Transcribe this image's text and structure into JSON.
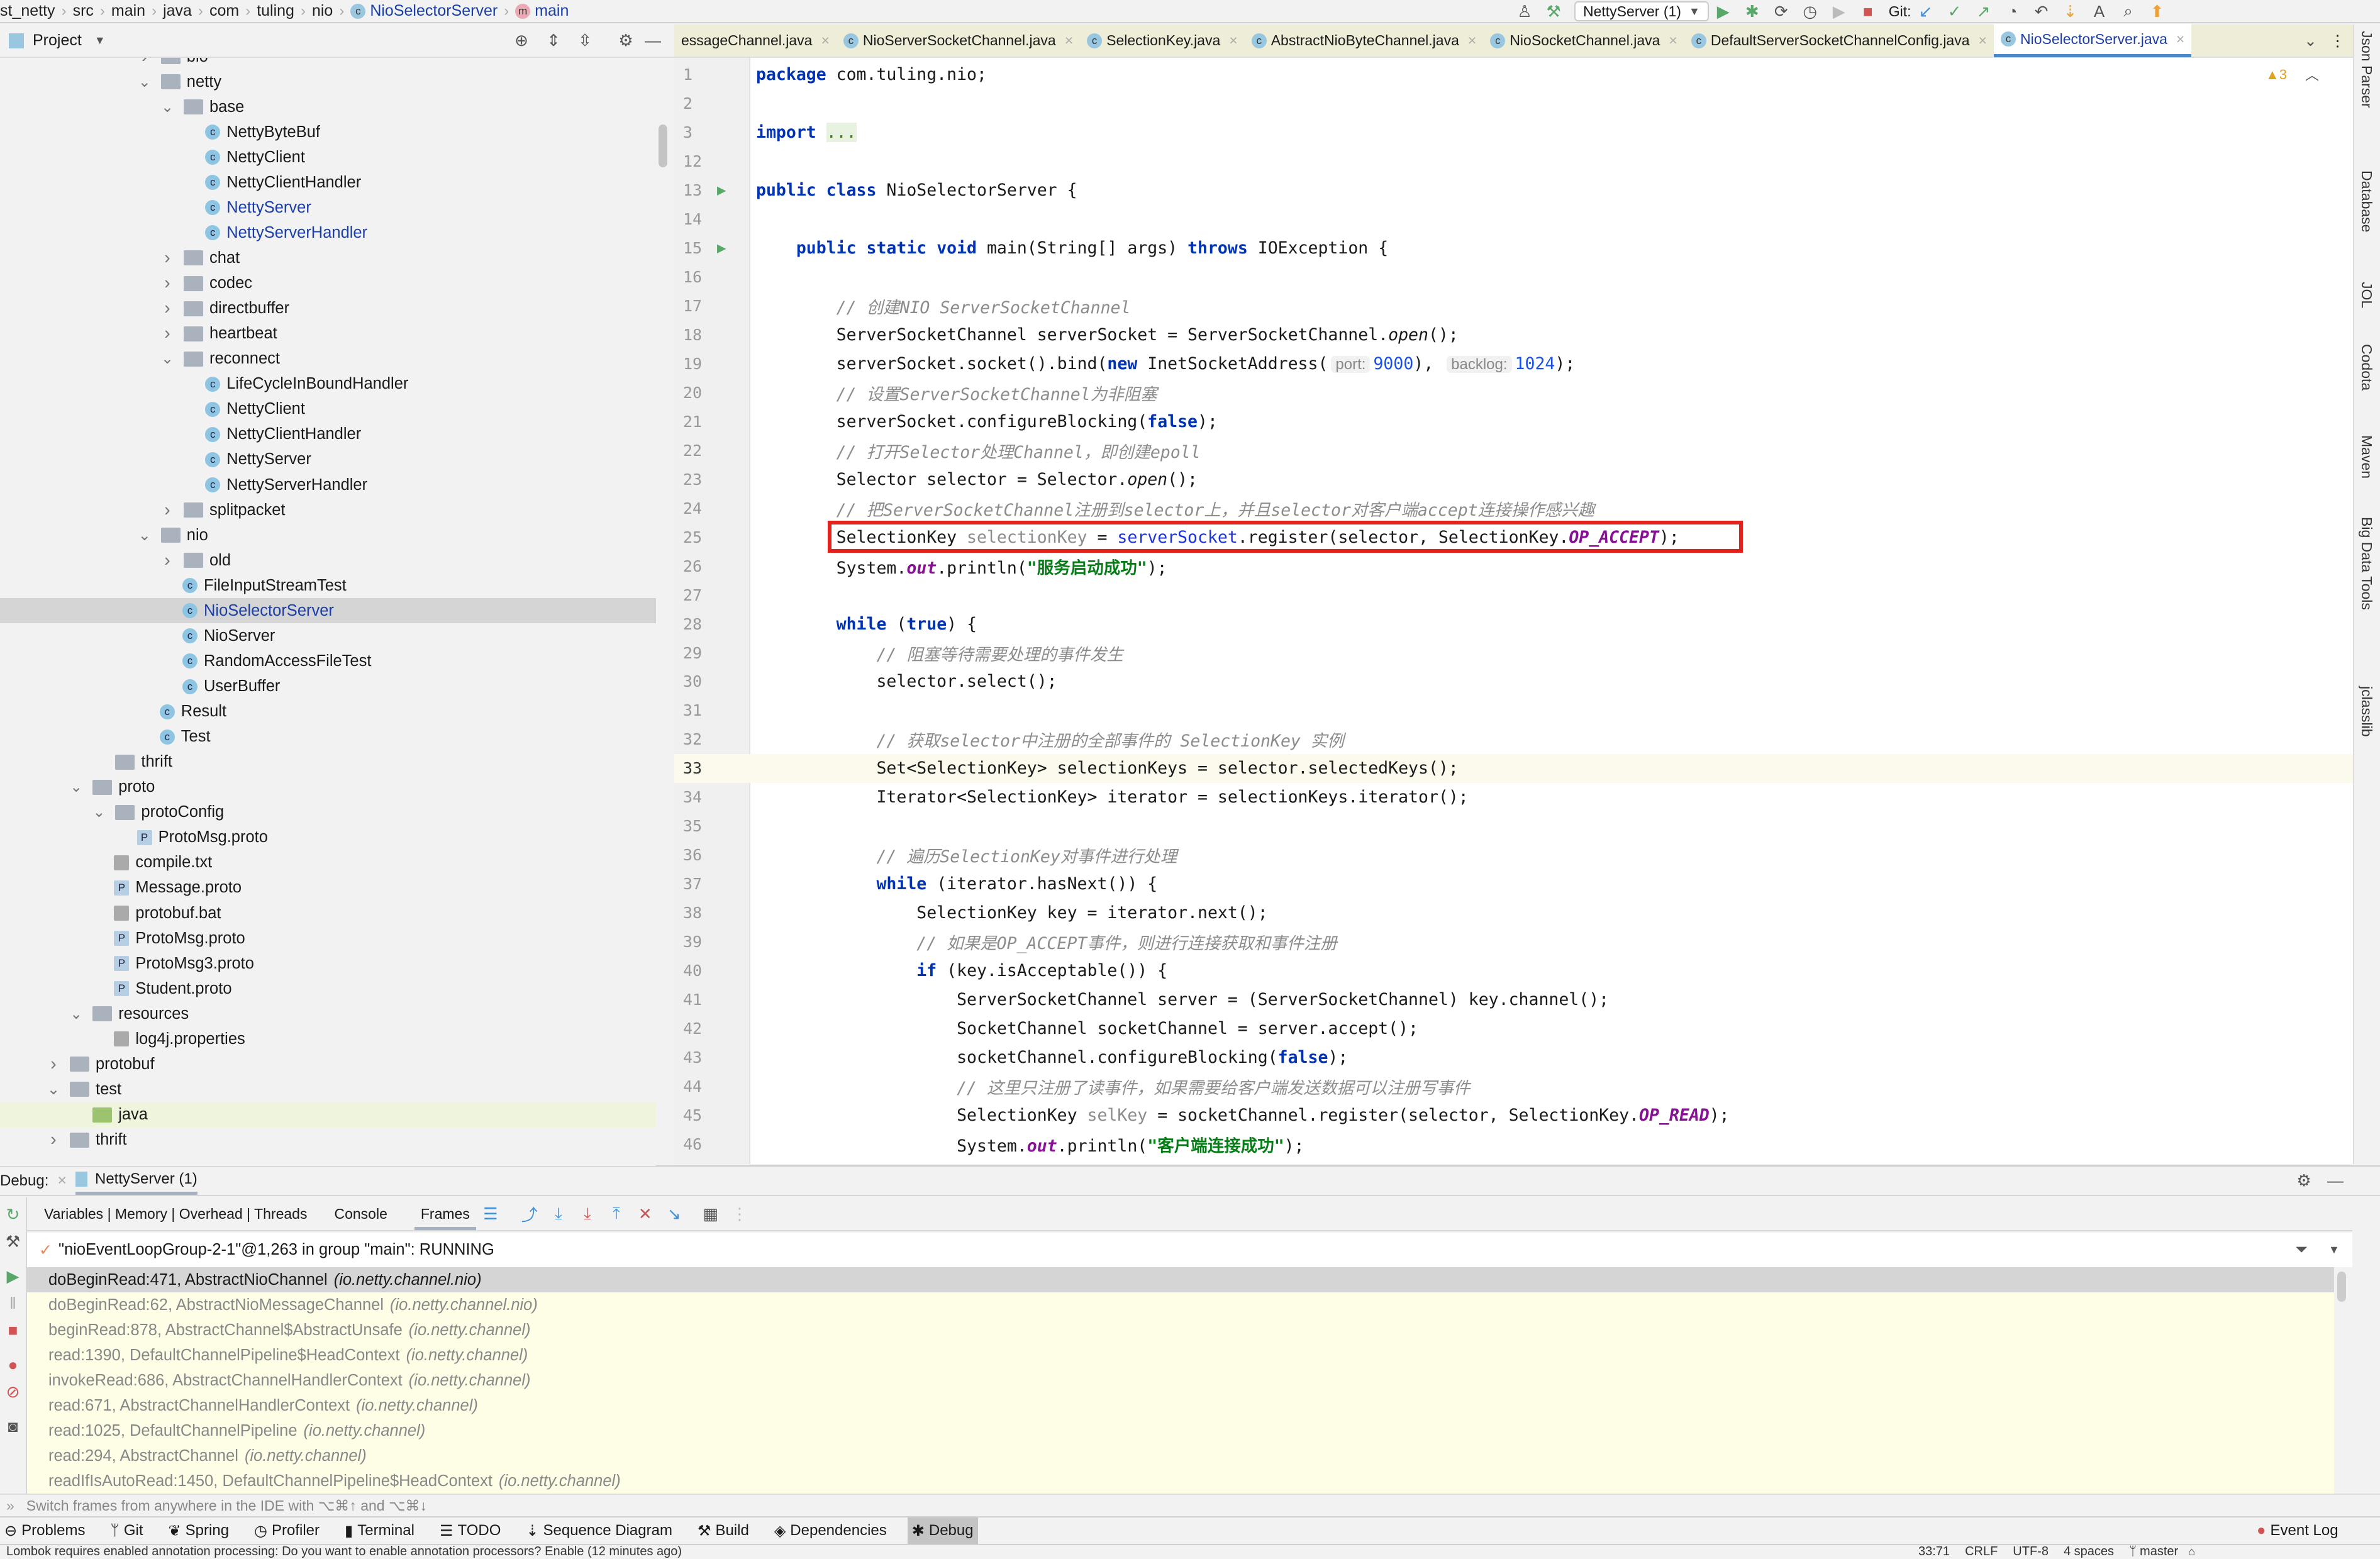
{
  "breadcrumb": [
    "st_netty",
    "src",
    "main",
    "java",
    "com",
    "tuling",
    "nio",
    "NioSelectorServer",
    "main"
  ],
  "toolbar": {
    "run_config": "NettyServer (1)",
    "git_label": "Git:"
  },
  "project": {
    "title": "Project"
  },
  "tabs": [
    "essageChannel.java",
    "NioServerSocketChannel.java",
    "SelectionKey.java",
    "AbstractNioByteChannel.java",
    "NioSocketChannel.java",
    "DefaultServerSocketChannelConfig.java",
    "NioSelectorServer.java"
  ],
  "active_tab": 6,
  "tree": [
    {
      "label": "bio",
      "level": 4,
      "type": "folder",
      "arrow": "right"
    },
    {
      "label": "netty",
      "level": 4,
      "type": "folder",
      "arrow": "down"
    },
    {
      "label": "base",
      "level": 5,
      "type": "folder",
      "arrow": "down"
    },
    {
      "label": "NettyByteBuf",
      "level": 6,
      "type": "class"
    },
    {
      "label": "NettyClient",
      "level": 6,
      "type": "class"
    },
    {
      "label": "NettyClientHandler",
      "level": 6,
      "type": "class"
    },
    {
      "label": "NettyServer",
      "level": 6,
      "type": "class",
      "blue": true
    },
    {
      "label": "NettyServerHandler",
      "level": 6,
      "type": "class",
      "blue": true
    },
    {
      "label": "chat",
      "level": 5,
      "type": "folder",
      "arrow": "right"
    },
    {
      "label": "codec",
      "level": 5,
      "type": "folder",
      "arrow": "right"
    },
    {
      "label": "directbuffer",
      "level": 5,
      "type": "folder",
      "arrow": "right"
    },
    {
      "label": "heartbeat",
      "level": 5,
      "type": "folder",
      "arrow": "right"
    },
    {
      "label": "reconnect",
      "level": 5,
      "type": "folder",
      "arrow": "down"
    },
    {
      "label": "LifeCycleInBoundHandler",
      "level": 6,
      "type": "class"
    },
    {
      "label": "NettyClient",
      "level": 6,
      "type": "class"
    },
    {
      "label": "NettyClientHandler",
      "level": 6,
      "type": "class"
    },
    {
      "label": "NettyServer",
      "level": 6,
      "type": "class"
    },
    {
      "label": "NettyServerHandler",
      "level": 6,
      "type": "class"
    },
    {
      "label": "splitpacket",
      "level": 5,
      "type": "folder",
      "arrow": "right"
    },
    {
      "label": "nio",
      "level": 4,
      "type": "folder",
      "arrow": "down"
    },
    {
      "label": "old",
      "level": 5,
      "type": "folder",
      "arrow": "right"
    },
    {
      "label": "FileInputStreamTest",
      "level": 5,
      "type": "class"
    },
    {
      "label": "NioSelectorServer",
      "level": 5,
      "type": "class",
      "blue": true,
      "selected": true
    },
    {
      "label": "NioServer",
      "level": 5,
      "type": "class"
    },
    {
      "label": "RandomAccessFileTest",
      "level": 5,
      "type": "class"
    },
    {
      "label": "UserBuffer",
      "level": 5,
      "type": "class"
    },
    {
      "label": "Result",
      "level": 4,
      "type": "class"
    },
    {
      "label": "Test",
      "level": 4,
      "type": "class"
    },
    {
      "label": "thrift",
      "level": 2,
      "type": "folder"
    },
    {
      "label": "proto",
      "level": 1,
      "type": "folder",
      "arrow": "down"
    },
    {
      "label": "protoConfig",
      "level": 2,
      "type": "folder",
      "arrow": "down"
    },
    {
      "label": "ProtoMsg.proto",
      "level": 3,
      "type": "proto"
    },
    {
      "label": "compile.txt",
      "level": 2,
      "type": "text"
    },
    {
      "label": "Message.proto",
      "level": 2,
      "type": "proto"
    },
    {
      "label": "protobuf.bat",
      "level": 2,
      "type": "text"
    },
    {
      "label": "ProtoMsg.proto",
      "level": 2,
      "type": "proto"
    },
    {
      "label": "ProtoMsg3.proto",
      "level": 2,
      "type": "proto"
    },
    {
      "label": "Student.proto",
      "level": 2,
      "type": "proto"
    },
    {
      "label": "resources",
      "level": 1,
      "type": "folder",
      "arrow": "down"
    },
    {
      "label": "log4j.properties",
      "level": 2,
      "type": "text"
    },
    {
      "label": "protobuf",
      "level": 0,
      "type": "folder",
      "arrow": "right"
    },
    {
      "label": "test",
      "level": 0,
      "type": "folder",
      "arrow": "down"
    },
    {
      "label": "java",
      "level": 1,
      "type": "folder",
      "highlight": true
    },
    {
      "label": "thrift",
      "level": 0,
      "type": "folder",
      "arrow": "right"
    }
  ],
  "editor": {
    "warnings": "▲3",
    "current_line": 33,
    "boxed_line": 25,
    "lines": [
      {
        "n": 1,
        "t": [
          [
            "package",
            "k"
          ],
          [
            " com.tuling.nio;",
            ""
          ]
        ]
      },
      {
        "n": 2,
        "t": []
      },
      {
        "n": 3,
        "t": [
          [
            "import",
            "k"
          ],
          [
            " ",
            ""
          ],
          [
            "...",
            "fo"
          ]
        ]
      },
      {
        "n": 12,
        "t": []
      },
      {
        "n": 13,
        "run": true,
        "t": [
          [
            "public class",
            "k"
          ],
          [
            " NioSelectorServer {",
            ""
          ]
        ]
      },
      {
        "n": 14,
        "t": []
      },
      {
        "n": 15,
        "run": true,
        "t": [
          [
            "    ",
            ""
          ],
          [
            "public static void",
            "k"
          ],
          [
            " main(String[] args) ",
            ""
          ],
          [
            "throws",
            "k"
          ],
          [
            " IOException {",
            ""
          ]
        ]
      },
      {
        "n": 16,
        "t": []
      },
      {
        "n": 17,
        "t": [
          [
            "        ",
            ""
          ],
          [
            "// 创建NIO ServerSocketChannel",
            "c"
          ]
        ]
      },
      {
        "n": 18,
        "t": [
          [
            "        ServerSocketChannel serverSocket = ServerSocketChannel.",
            ""
          ],
          [
            "open",
            "i"
          ],
          [
            "();",
            ""
          ]
        ]
      },
      {
        "n": 19,
        "t": [
          [
            "        serverSocket.socket().bind(",
            ""
          ],
          [
            "new",
            "k"
          ],
          [
            " InetSocketAddress(",
            ""
          ],
          [
            "port:",
            "h"
          ],
          [
            "9000",
            "n"
          ],
          [
            "), ",
            ""
          ],
          [
            "backlog:",
            "h"
          ],
          [
            "1024",
            "n"
          ],
          [
            ");",
            ""
          ]
        ]
      },
      {
        "n": 20,
        "t": [
          [
            "        ",
            ""
          ],
          [
            "// 设置ServerSocketChannel为非阻塞",
            "c"
          ]
        ]
      },
      {
        "n": 21,
        "t": [
          [
            "        serverSocket.configureBlocking(",
            ""
          ],
          [
            "false",
            "k"
          ],
          [
            ");",
            ""
          ]
        ]
      },
      {
        "n": 22,
        "t": [
          [
            "        ",
            ""
          ],
          [
            "// 打开Selector处理Channel，即创建epoll",
            "c"
          ]
        ]
      },
      {
        "n": 23,
        "t": [
          [
            "        Selector selector = Selector.",
            ""
          ],
          [
            "open",
            "i"
          ],
          [
            "();",
            ""
          ]
        ]
      },
      {
        "n": 24,
        "t": [
          [
            "        ",
            ""
          ],
          [
            "// 把ServerSocketChannel注册到selector上，并且selector对客户端accept连接操作感兴趣",
            "c"
          ]
        ]
      },
      {
        "n": 25,
        "t": [
          [
            "        SelectionKey ",
            ""
          ],
          [
            "selectionKey",
            "v"
          ],
          [
            " = ",
            ""
          ],
          [
            "serverSocket",
            "b"
          ],
          [
            ".register(selector, SelectionKey.",
            ""
          ],
          [
            "OP_ACCEPT",
            "f"
          ],
          [
            ");",
            ""
          ]
        ]
      },
      {
        "n": 26,
        "t": [
          [
            "        System.",
            ""
          ],
          [
            "out",
            "f"
          ],
          [
            ".println(",
            ""
          ],
          [
            "\"服务启动成功\"",
            "s"
          ],
          [
            ");",
            ""
          ]
        ]
      },
      {
        "n": 27,
        "t": []
      },
      {
        "n": 28,
        "t": [
          [
            "        ",
            ""
          ],
          [
            "while",
            "k"
          ],
          [
            " (",
            ""
          ],
          [
            "true",
            "k"
          ],
          [
            ") {",
            ""
          ]
        ]
      },
      {
        "n": 29,
        "t": [
          [
            "            ",
            ""
          ],
          [
            "// 阻塞等待需要处理的事件发生",
            "c"
          ]
        ]
      },
      {
        "n": 30,
        "t": [
          [
            "            selector.select();",
            ""
          ]
        ]
      },
      {
        "n": 31,
        "t": []
      },
      {
        "n": 32,
        "t": [
          [
            "            ",
            ""
          ],
          [
            "// 获取selector中注册的全部事件的 SelectionKey 实例",
            "c"
          ]
        ]
      },
      {
        "n": 33,
        "t": [
          [
            "            Set<SelectionKey> selectionKeys = selector.selectedKeys();",
            ""
          ]
        ]
      },
      {
        "n": 34,
        "t": [
          [
            "            Iterator<SelectionKey> iterator = selectionKeys.iterator();",
            ""
          ]
        ]
      },
      {
        "n": 35,
        "t": []
      },
      {
        "n": 36,
        "t": [
          [
            "            ",
            ""
          ],
          [
            "// 遍历SelectionKey对事件进行处理",
            "c"
          ]
        ]
      },
      {
        "n": 37,
        "t": [
          [
            "            ",
            ""
          ],
          [
            "while",
            "k"
          ],
          [
            " (iterator.hasNext()) {",
            ""
          ]
        ]
      },
      {
        "n": 38,
        "t": [
          [
            "                SelectionKey key = iterator.next();",
            ""
          ]
        ]
      },
      {
        "n": 39,
        "t": [
          [
            "                ",
            ""
          ],
          [
            "// 如果是OP_ACCEPT事件，则进行连接获取和事件注册",
            "c"
          ]
        ]
      },
      {
        "n": 40,
        "t": [
          [
            "                ",
            ""
          ],
          [
            "if",
            "k"
          ],
          [
            " (key.isAcceptable()) {",
            ""
          ]
        ]
      },
      {
        "n": 41,
        "t": [
          [
            "                    ServerSocketChannel server = (ServerSocketChannel) key.channel();",
            ""
          ]
        ]
      },
      {
        "n": 42,
        "t": [
          [
            "                    SocketChannel socketChannel = server.accept();",
            ""
          ]
        ]
      },
      {
        "n": 43,
        "t": [
          [
            "                    socketChannel.configureBlocking(",
            ""
          ],
          [
            "false",
            "k"
          ],
          [
            ");",
            ""
          ]
        ]
      },
      {
        "n": 44,
        "t": [
          [
            "                    ",
            ""
          ],
          [
            "// 这里只注册了读事件，如果需要给客户端发送数据可以注册写事件",
            "c"
          ]
        ]
      },
      {
        "n": 45,
        "t": [
          [
            "                    SelectionKey ",
            ""
          ],
          [
            "selKey",
            "v"
          ],
          [
            " = socketChannel.register(selector, SelectionKey.",
            ""
          ],
          [
            "OP_READ",
            "f"
          ],
          [
            ");",
            ""
          ]
        ]
      },
      {
        "n": 46,
        "t": [
          [
            "                    System.",
            ""
          ],
          [
            "out",
            "f"
          ],
          [
            ".println(",
            ""
          ],
          [
            "\"客户端连接成功\"",
            "s"
          ],
          [
            ");",
            ""
          ]
        ]
      }
    ]
  },
  "right_tools": [
    "Json Parser",
    "Database",
    "JOL",
    "Codota",
    "Maven",
    "Big Data Tools",
    "jclasslib"
  ],
  "debug": {
    "label": "Debug:",
    "session": "NettyServer (1)",
    "tabs": [
      "Variables | Memory | Overhead | Threads",
      "Console",
      "Frames"
    ],
    "thread": "\"nioEventLoopGroup-2-1\"@1,263 in group \"main\": RUNNING",
    "frames": [
      [
        "doBeginRead:471, AbstractNioChannel",
        "(io.netty.channel.nio)"
      ],
      [
        "doBeginRead:62, AbstractNioMessageChannel",
        "(io.netty.channel.nio)"
      ],
      [
        "beginRead:878, AbstractChannel$AbstractUnsafe",
        "(io.netty.channel)"
      ],
      [
        "read:1390, DefaultChannelPipeline$HeadContext",
        "(io.netty.channel)"
      ],
      [
        "invokeRead:686, AbstractChannelHandlerContext",
        "(io.netty.channel)"
      ],
      [
        "read:671, AbstractChannelHandlerContext",
        "(io.netty.channel)"
      ],
      [
        "read:1025, DefaultChannelPipeline",
        "(io.netty.channel)"
      ],
      [
        "read:294, AbstractChannel",
        "(io.netty.channel)"
      ],
      [
        "readIfIsAutoRead:1450, DefaultChannelPipeline$HeadContext",
        "(io.netty.channel)"
      ]
    ],
    "hint": "Switch frames from anywhere in the IDE with ⌥⌘↑ and ⌥⌘↓"
  },
  "toolwindows": [
    "Problems",
    "Git",
    "Spring",
    "Profiler",
    "Terminal",
    "TODO",
    "Sequence Diagram",
    "Build",
    "Dependencies",
    "Debug"
  ],
  "event_log": "Event Log",
  "status": {
    "message": "Lombok requires enabled annotation processing: Do you want to enable annotation processors? Enable (12 minutes ago)",
    "position": "33:71",
    "line_sep": "CRLF",
    "encoding": "UTF-8",
    "indent": "4 spaces",
    "branch": "master"
  },
  "colors": {
    "accent": "#4a88c7",
    "highlight_box": "#e0231c",
    "current_line": "#fcfaed",
    "frames_bg": "#fefee6"
  }
}
